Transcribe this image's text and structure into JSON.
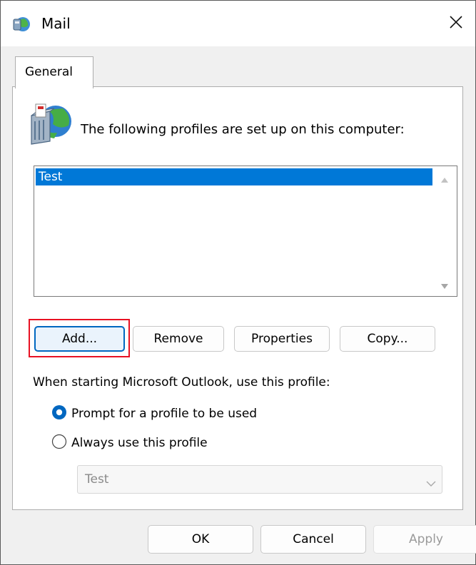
{
  "window": {
    "title": "Mail",
    "close_glyph": "✕"
  },
  "tabs": [
    {
      "label": "General"
    }
  ],
  "general": {
    "intro_text": "The following profiles are set up on this computer:",
    "profiles": [
      {
        "name": "Test",
        "selected": true
      }
    ],
    "buttons": {
      "add": "Add...",
      "remove": "Remove",
      "properties": "Properties",
      "copy": "Copy..."
    },
    "startup_label": "When starting Microsoft Outlook, use this profile:",
    "options": [
      {
        "label": "Prompt for a profile to be used",
        "checked": true
      },
      {
        "label": "Always use this profile",
        "checked": false
      }
    ],
    "profile_dropdown": {
      "value": "Test",
      "enabled": false
    }
  },
  "footer": {
    "ok": "OK",
    "cancel": "Cancel",
    "apply": "Apply"
  },
  "colors": {
    "selection": "#0078d7",
    "radio_checked": "#0067c0",
    "highlight": "#e81123"
  },
  "icons": {
    "app": "mail-globe-icon",
    "profiles": "profiles-mailbox-icon",
    "close": "close-icon"
  }
}
